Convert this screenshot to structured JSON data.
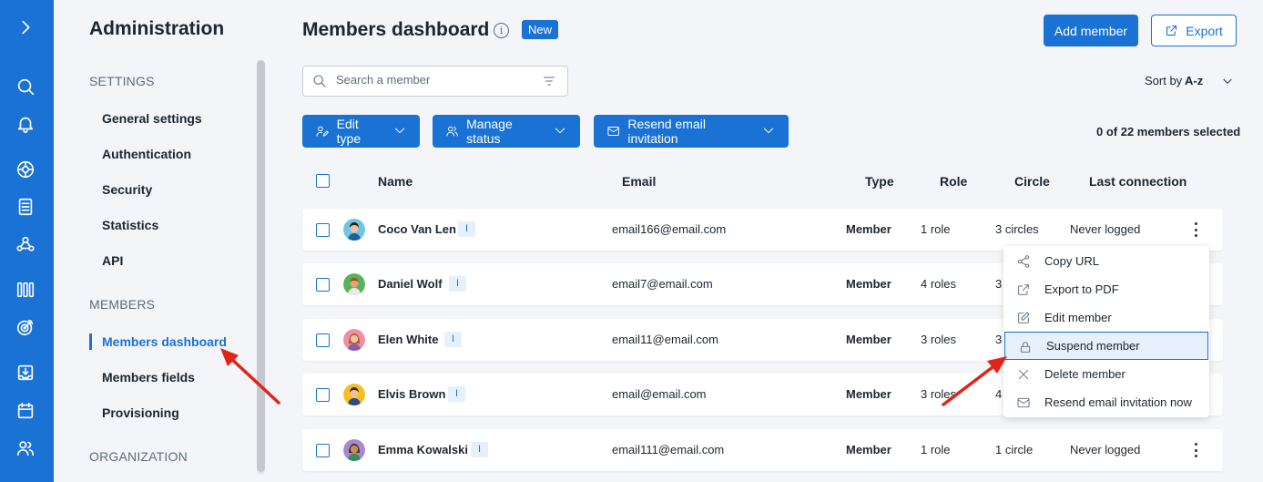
{
  "rail": {
    "icons": [
      "chevron-right-icon",
      "search-icon",
      "bell-icon",
      "globe-icon",
      "document-icon",
      "people-network-icon",
      "columns-icon",
      "target-icon",
      "inbox-icon",
      "calendar-icon",
      "users-icon"
    ]
  },
  "sidebar": {
    "title": "Administration",
    "sections": {
      "settings": "SETTINGS",
      "members": "MEMBERS",
      "organization": "ORGANIZATION"
    },
    "settings_items": [
      "General settings",
      "Authentication",
      "Security",
      "Statistics",
      "API"
    ],
    "members_items": [
      "Members dashboard",
      "Members fields",
      "Provisioning"
    ],
    "active_item": "Members dashboard"
  },
  "header": {
    "title": "Members dashboard",
    "info_icon_glyph": "i",
    "badge": "New",
    "add_member": "Add member",
    "export": "Export"
  },
  "search": {
    "placeholder": "Search a member"
  },
  "sort": {
    "label": "Sort by",
    "value": "A-z"
  },
  "actions": {
    "edit_type": "Edit type",
    "manage_status": "Manage status",
    "resend_invitation": "Resend email invitation"
  },
  "selection": {
    "summary": "0 of 22 members selected"
  },
  "table": {
    "columns": {
      "name": "Name",
      "email": "Email",
      "type": "Type",
      "role": "Role",
      "circle": "Circle",
      "last_connection": "Last connection"
    },
    "rows": [
      {
        "name": "Coco Van Len",
        "badge": "I",
        "email": "email166@email.com",
        "type": "Member",
        "role": "1 role",
        "circle": "3 circles",
        "last_connection": "Never logged"
      },
      {
        "name": "Daniel Wolf",
        "badge": "I",
        "email": "email7@email.com",
        "type": "Member",
        "role": "4 roles",
        "circle": "3",
        "last_connection": ""
      },
      {
        "name": "Elen White",
        "badge": "I",
        "email": "email11@email.com",
        "type": "Member",
        "role": "3 roles",
        "circle": "3",
        "last_connection": ""
      },
      {
        "name": "Elvis Brown",
        "badge": "I",
        "email": "email@email.com",
        "type": "Member",
        "role": "3 roles",
        "circle": "4",
        "last_connection": ""
      },
      {
        "name": "Emma Kowalski",
        "badge": "I",
        "email": "email111@email.com",
        "type": "Member",
        "role": "1 role",
        "circle": "1 circle",
        "last_connection": "Never logged"
      }
    ]
  },
  "context_menu": {
    "items": [
      "Copy URL",
      "Export to PDF",
      "Edit member",
      "Suspend member",
      "Delete member",
      "Resend email invitation now"
    ],
    "highlighted": "Suspend member"
  },
  "colors": {
    "brand": "#1a72d4",
    "annotation_arrow": "#e2231a",
    "background": "#f3f5f8"
  }
}
